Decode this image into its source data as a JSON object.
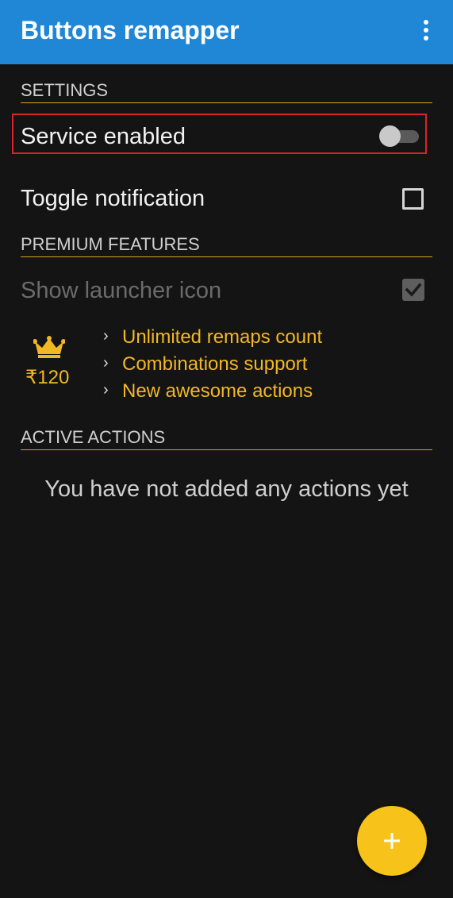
{
  "app_bar": {
    "title": "Buttons remapper",
    "color": "#1f87d6",
    "overflow_icon": "more-vert-icon"
  },
  "settings": {
    "header": "SETTINGS",
    "service_enabled": {
      "label": "Service enabled",
      "state": "off"
    },
    "toggle_notification": {
      "label": "Toggle notification",
      "checked": false
    }
  },
  "premium": {
    "header": "PREMIUM FEATURES",
    "show_launcher_icon": {
      "label": "Show launcher icon",
      "checked": true,
      "enabled": false
    },
    "price": "₹120",
    "crown_icon": "crown-icon",
    "features": [
      "Unlimited remaps count",
      "Combinations support",
      "New awesome actions"
    ],
    "accent_color": "#f2b824"
  },
  "active_actions": {
    "header": "ACTIVE ACTIONS",
    "empty_message": "You have not added any actions yet"
  },
  "fab": {
    "icon": "plus-icon",
    "color": "#f7c31b"
  }
}
